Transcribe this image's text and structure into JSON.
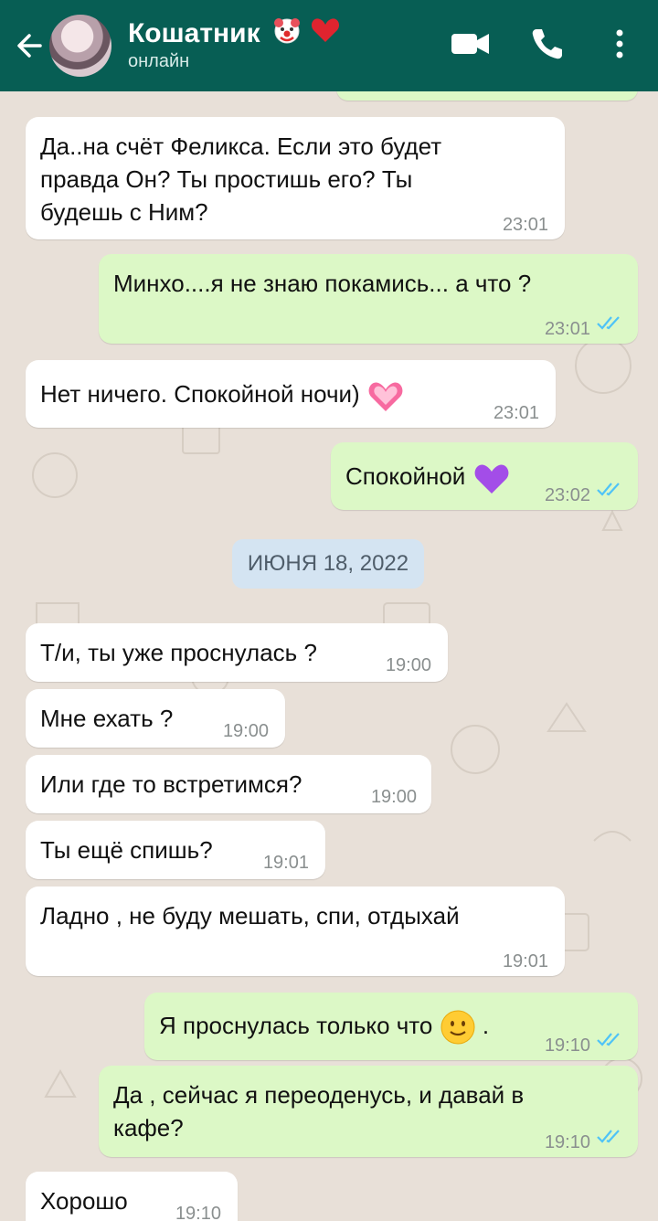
{
  "header": {
    "contact_name": "Кошатник",
    "status": "онлайн",
    "icons": [
      "back-arrow-icon",
      "clown-face-icon",
      "red-heart-icon",
      "video-call-icon",
      "phone-icon",
      "more-options-icon"
    ]
  },
  "colors": {
    "header": "#075e54",
    "incoming": "#ffffff",
    "outgoing": "#dcf8c6",
    "read_ticks": "#4fc3f7",
    "date_badge": "#d4e4f2"
  },
  "messages": [
    {
      "id": "m1",
      "direction": "in",
      "lines": [
        "Да..на счёт Феликса.  Если это будет",
        "правда Он? Ты простишь его? Ты",
        "будешь с Ним?"
      ],
      "time": "23:01"
    },
    {
      "id": "m2",
      "direction": "out",
      "text": "Минхо....я не знаю покамись... а что ?",
      "time": "23:01",
      "read": true
    },
    {
      "id": "m3",
      "direction": "in",
      "text": "Нет ничего.  Спокойной ночи)",
      "emoji": "sparkling-heart-icon",
      "time": "23:01"
    },
    {
      "id": "m4",
      "direction": "out",
      "text": "Спокойной",
      "emoji": "purple-heart-icon",
      "time": "23:02",
      "read": true
    },
    {
      "id": "m5",
      "direction": "in",
      "text": "Т/и, ты уже проснулась ?",
      "time": "19:00"
    },
    {
      "id": "m6",
      "direction": "in",
      "text": "Мне ехать ?",
      "time": "19:00"
    },
    {
      "id": "m7",
      "direction": "in",
      "text": "Или где то встретимся?",
      "time": "19:00"
    },
    {
      "id": "m8",
      "direction": "in",
      "text": "Ты ещё спишь?",
      "time": "19:01"
    },
    {
      "id": "m9",
      "direction": "in",
      "text": "Ладно , не буду мешать, спи, отдыхай",
      "time": "19:01"
    },
    {
      "id": "m10",
      "direction": "out",
      "text": "Я проснулась только что",
      "emoji": "slightly-smiling-face-icon",
      "suffix": ".",
      "time": "19:10",
      "read": true
    },
    {
      "id": "m11",
      "direction": "out",
      "lines": [
        "Да , сейчас я переоденусь, и давай в",
        "кафе?"
      ],
      "time": "19:10",
      "read": true
    },
    {
      "id": "m12",
      "direction": "in",
      "text": "Хорошо",
      "time": "19:10"
    }
  ],
  "date_separator": "ИЮНЯ 18, 2022"
}
